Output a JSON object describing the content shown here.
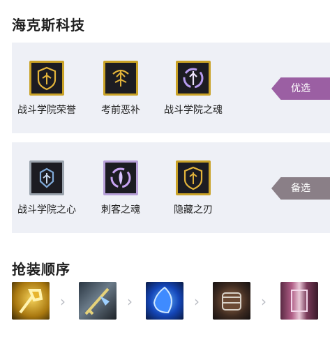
{
  "sections": {
    "hextech_title": "海克斯科技",
    "build_title": "抢装顺序"
  },
  "rows": [
    {
      "tag": "优选",
      "items": [
        {
          "label": "战斗学院荣誉",
          "icon": "shield-emblem-icon"
        },
        {
          "label": "考前恶补",
          "icon": "upgrade-emblem-icon"
        },
        {
          "label": "战斗学院之魂",
          "icon": "soul-emblem-icon"
        }
      ]
    },
    {
      "tag": "备选",
      "items": [
        {
          "label": "战斗学院之心",
          "icon": "heart-emblem-icon"
        },
        {
          "label": "刺客之魂",
          "icon": "assassin-soul-icon"
        },
        {
          "label": "隐藏之刃",
          "icon": "hidden-blade-icon"
        }
      ]
    }
  ],
  "build_order": [
    {
      "icon": "golden-spatula-icon"
    },
    {
      "icon": "blade-item-icon"
    },
    {
      "icon": "blue-gem-icon"
    },
    {
      "icon": "armored-gauntlet-icon"
    },
    {
      "icon": "purple-book-icon"
    }
  ],
  "colors": {
    "panel_bg": "#eef0f6",
    "gold_border": "#c9a227",
    "tag_primary": "#9b5fa3",
    "tag_backup": "#8a7f87"
  }
}
